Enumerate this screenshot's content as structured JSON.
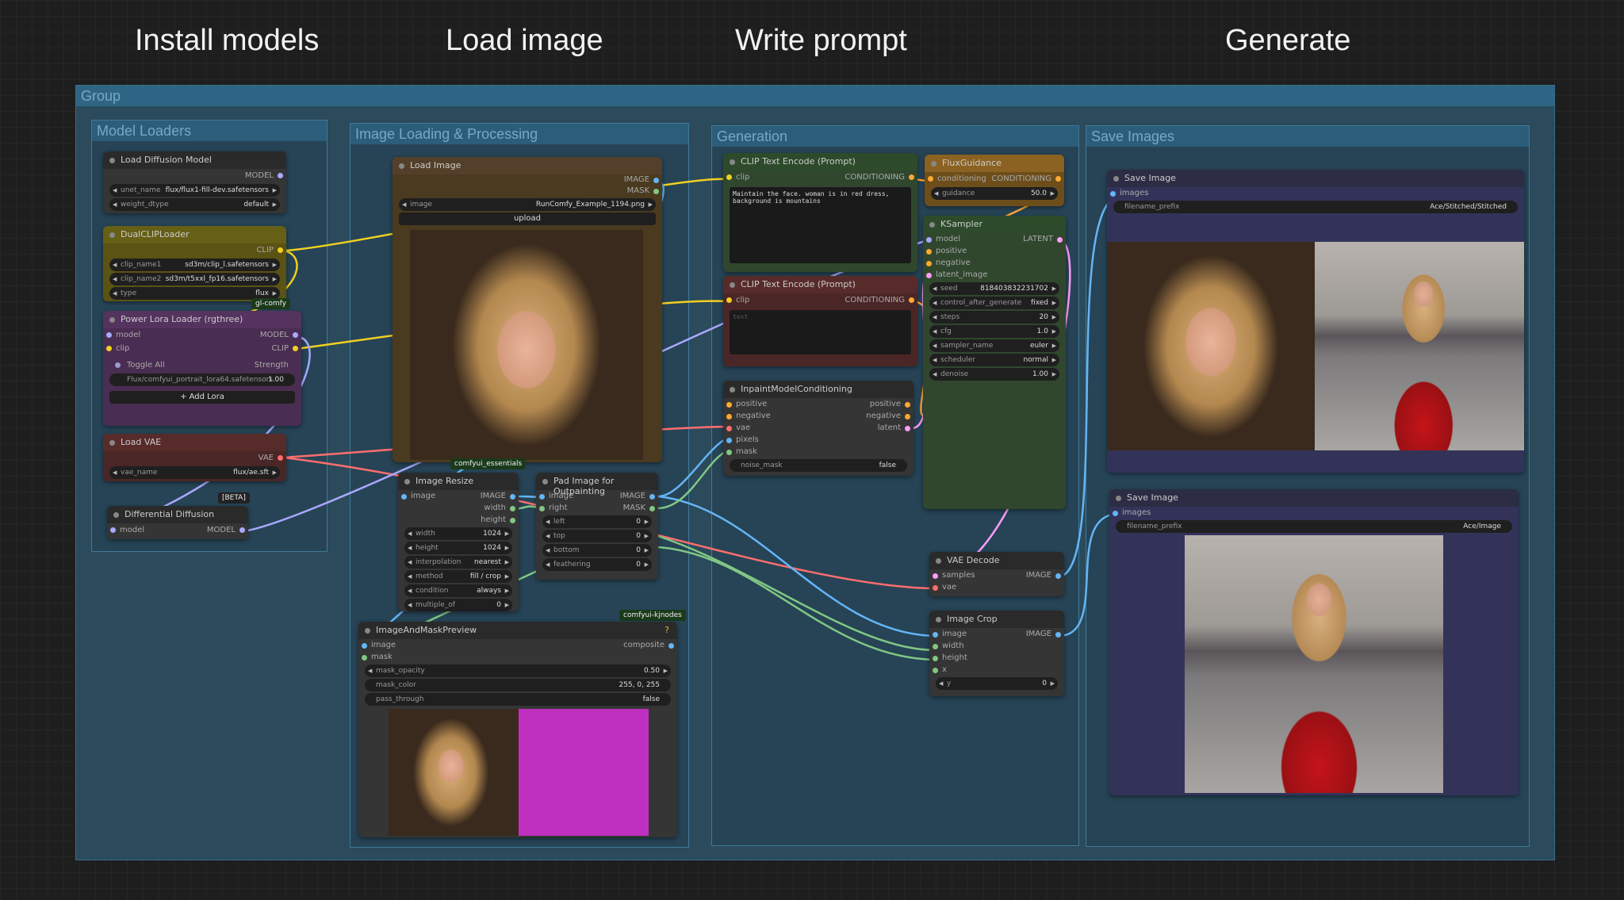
{
  "steps": [
    "Install models",
    "Load image",
    "Write prompt",
    "Generate"
  ],
  "groups": {
    "outer": "Group",
    "model_loaders": "Model Loaders",
    "image_loading": "Image Loading & Processing",
    "generation": "Generation",
    "save_images": "Save Images"
  },
  "nodes": {
    "load_diffusion": {
      "title": "Load Diffusion Model",
      "out": "MODEL",
      "unet_k": "unet_name",
      "unet_v": "flux/flux1-fill-dev.safetensors",
      "dtype_k": "weight_dtype",
      "dtype_v": "default"
    },
    "dual_clip": {
      "title": "DualCLIPLoader",
      "out": "CLIP",
      "c1_k": "clip_name1",
      "c1_v": "sd3m/clip_l.safetensors",
      "c2_k": "clip_name2",
      "c2_v": "sd3m/t5xxl_fp16.safetensors",
      "type_k": "type",
      "type_v": "flux",
      "badge": "gl-comfy"
    },
    "power_lora": {
      "title": "Power Lora Loader (rgthree)",
      "in_model": "model",
      "in_clip": "clip",
      "out_model": "MODEL",
      "out_clip": "CLIP",
      "toggle": "Toggle All",
      "strength": "Strength",
      "lora": "Flux/comfyui_portrait_lora64.safetensors",
      "lora_val": "1.00",
      "add": "+ Add Lora"
    },
    "load_vae": {
      "title": "Load VAE",
      "out": "VAE",
      "k": "vae_name",
      "v": "flux/ae.sft",
      "beta": "[BETA]"
    },
    "diff_diffusion": {
      "title": "Differential Diffusion",
      "in": "model",
      "out": "MODEL"
    },
    "load_image": {
      "title": "Load Image",
      "out_image": "IMAGE",
      "out_mask": "MASK",
      "k": "image",
      "v": "RunComfy_Example_1194.png",
      "upload": "upload",
      "badge": "comfyui_essentials"
    },
    "image_resize": {
      "title": "Image Resize",
      "in": "image",
      "o1": "IMAGE",
      "o2": "width",
      "o3": "height",
      "w_k": "width",
      "w_v": "1024",
      "h_k": "height",
      "h_v": "1024",
      "i_k": "interpolation",
      "i_v": "nearest",
      "m_k": "method",
      "m_v": "fill / crop",
      "c_k": "condition",
      "c_v": "always",
      "mo_k": "multiple_of",
      "mo_v": "0"
    },
    "pad_image": {
      "title": "Pad Image for Outpainting",
      "in1": "image",
      "in2": "right",
      "o1": "IMAGE",
      "o2": "MASK",
      "l_k": "left",
      "l_v": "0",
      "t_k": "top",
      "t_v": "0",
      "b_k": "bottom",
      "b_v": "0",
      "f_k": "feathering",
      "f_v": "0",
      "badge": "comfyui-kjnodes"
    },
    "mask_preview": {
      "title": "ImageAndMaskPreview",
      "in1": "image",
      "in2": "mask",
      "out": "composite",
      "q": "?",
      "op_k": "mask_opacity",
      "op_v": "0.50",
      "col_k": "mask_color",
      "col_v": "255, 0, 255",
      "pt_k": "pass_through",
      "pt_v": "false"
    },
    "clip_pos": {
      "title": "CLIP Text Encode (Prompt)",
      "in": "clip",
      "out": "CONDITIONING",
      "text": "Maintain the face. woman is in red dress, background is mountains"
    },
    "clip_neg": {
      "title": "CLIP Text Encode (Prompt)",
      "in": "clip",
      "out": "CONDITIONING",
      "placeholder": "text"
    },
    "inpaint": {
      "title": "InpaintModelConditioning",
      "i1": "positive",
      "i2": "negative",
      "i3": "vae",
      "i4": "pixels",
      "i5": "mask",
      "o1": "positive",
      "o2": "negative",
      "o3": "latent",
      "nm_k": "noise_mask",
      "nm_v": "false"
    },
    "flux_guidance": {
      "title": "FluxGuidance",
      "in": "conditioning",
      "out": "CONDITIONING",
      "k": "guidance",
      "v": "50.0"
    },
    "ksampler": {
      "title": "KSampler",
      "i1": "model",
      "i2": "positive",
      "i3": "negative",
      "i4": "latent_image",
      "out": "LATENT",
      "seed_k": "seed",
      "seed_v": "818403832231702",
      "cag_k": "control_after_generate",
      "cag_v": "fixed",
      "steps_k": "steps",
      "steps_v": "20",
      "cfg_k": "cfg",
      "cfg_v": "1.0",
      "sn_k": "sampler_name",
      "sn_v": "euler",
      "sch_k": "scheduler",
      "sch_v": "normal",
      "den_k": "denoise",
      "den_v": "1.00"
    },
    "vae_decode": {
      "title": "VAE Decode",
      "i1": "samples",
      "i2": "vae",
      "out": "IMAGE"
    },
    "image_crop": {
      "title": "Image Crop",
      "i1": "image",
      "i2": "width",
      "i3": "height",
      "i4": "x",
      "out": "IMAGE",
      "y_k": "y",
      "y_v": "0"
    },
    "save1": {
      "title": "Save Image",
      "in": "images",
      "k": "filename_prefix",
      "v": "Ace/Stitched/Stitched"
    },
    "save2": {
      "title": "Save Image",
      "in": "images",
      "k": "filename_prefix",
      "v": "Ace/Image"
    }
  },
  "colors": {
    "clip": "#f0d020",
    "vae": "#ff6e6e",
    "model": "#a8a8ff",
    "image": "#64b5f6",
    "cond": "#ffa931",
    "latent": "#ff9cf9",
    "mask": "#81c784",
    "mask_magenta": "#c030c0"
  }
}
